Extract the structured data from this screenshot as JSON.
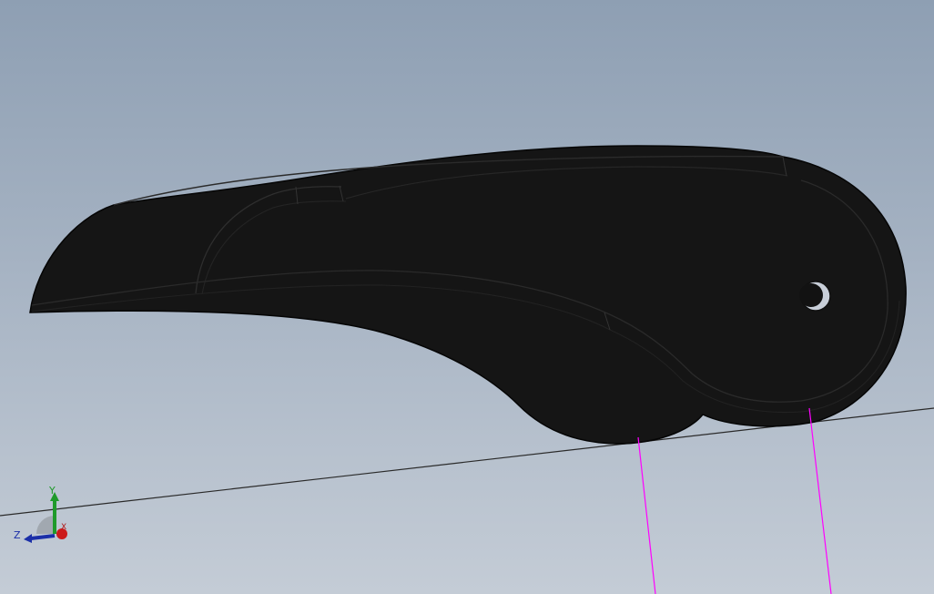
{
  "viewport": {
    "background_top": "#8e9fb3",
    "background_bottom": "#c4ccd6"
  },
  "model": {
    "body_color": "#151515",
    "edge_color": "#050505",
    "sketch_line_color": "#ff00ff",
    "ground_line_color": "#2a2a2a"
  },
  "triad": {
    "x_label": "X",
    "y_label": "Y",
    "z_label": "Z",
    "x_color": "#cc1a1a",
    "y_color": "#1f9a2a",
    "z_color": "#1b2fa8"
  }
}
